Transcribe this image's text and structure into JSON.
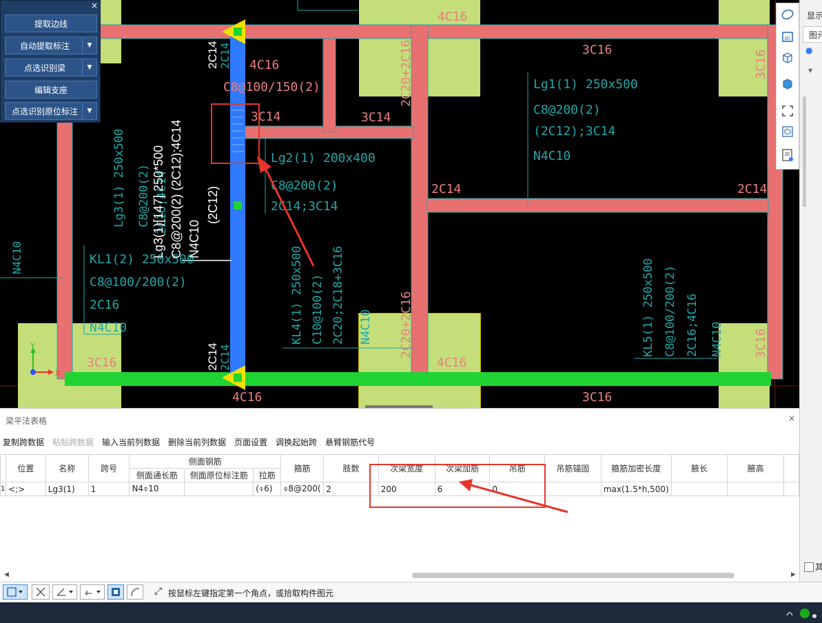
{
  "colors": {
    "canvas_bg": "#000000",
    "beam": "#e87070",
    "selected_beam": "#2f7bff",
    "bottom_beam": "#1ed432",
    "column": "#c4de7a",
    "annotation_text": "#1fa8a8",
    "annotation_red": "#e8342a",
    "white_text": "#ffffff",
    "pink_text": "#e88080",
    "axis_x": "#e8342a",
    "axis_y": "#22c422",
    "yellow_marker": "#f0e000"
  },
  "float_panel": {
    "close_icon": "×",
    "buttons": [
      {
        "label": "提取边线",
        "has_dropdown": false
      },
      {
        "label": "自动提取标注",
        "has_dropdown": true
      },
      {
        "label": "点选识别梁",
        "has_dropdown": true
      },
      {
        "label": "编辑支座",
        "has_dropdown": false
      },
      {
        "label": "点选识别原位标注",
        "has_dropdown": true
      }
    ],
    "dropdown_glyph": "▼"
  },
  "cad": {
    "beam_labels": {
      "kl1": [
        "KL1(2) 250x500",
        "C8@100/200(2)",
        "2C16",
        "N4C10"
      ],
      "lg3_teal": [
        "Lg3(1) 250x500",
        "C8@200(2)",
        "2C16;4C14"
      ],
      "lg3_white": [
        "Lg3(1)[147] 250*500",
        "C8@200(2) (2C12);4C14",
        "N4C10",
        "(2C12)"
      ],
      "lg1": [
        "Lg1(1) 250x500",
        "C8@200(2)",
        "(2C12);3C14",
        "N4C10"
      ],
      "lg2": [
        "Lg2(1) 200x400",
        "C8@200(2)",
        "2C14;3C14"
      ],
      "kl4": [
        "KL4(1) 250x500",
        "C10@100(2)",
        "2C20;2C18+3C16",
        "N4C10"
      ],
      "kl5": [
        "KL5(1) 250x500",
        "C8@100/200(2)",
        "2C16;4C16",
        "N4C10"
      ]
    },
    "misc_labels": {
      "top_4c16": "4C16",
      "top_3c16": "3C16",
      "right_3c16": "3C16",
      "mid_4c16": "4C16",
      "c8_100_150": "C8@100/150(2)",
      "left_3c14": "3C14",
      "mid_3c14": "3C14",
      "left_2c14": "2C14",
      "right_2c14": "2C14",
      "vert_2c20_top": "2C20+2C16",
      "vert_2c20_bot": "2C20+2C16",
      "white_2c14_top": "2C14",
      "teal_2c14_top": "2C14",
      "white_2c14_bot": "2C14",
      "teal_2c14_bot": "2C14",
      "left_3c16_bot": "3C16",
      "bot_4c16_left": "4C16",
      "bot_4c16_mid": "4C16",
      "bot_3c16": "3C16",
      "left_n4c10": "N4C10",
      "right_3c16_bot": "3C16",
      "kl4_n4c10": "N4C10"
    },
    "axis": {
      "x": "X",
      "y": "Y"
    }
  },
  "view_toolbar": {
    "icons": [
      "orbit-icon",
      "view-3d-icon",
      "cube-icon",
      "cube-solid-icon",
      "zoom-extents-icon",
      "component-icon",
      "properties-icon"
    ],
    "label_3d": "3D"
  },
  "right_panel": {
    "title": "显示",
    "tab": "图元",
    "radio": "●",
    "tree_arrow": "▼",
    "bottom_check": "其"
  },
  "bottom_panel": {
    "title": "梁平法表格",
    "close": "×",
    "menu": [
      {
        "label": "复制跨数据",
        "disabled": false
      },
      {
        "label": "粘贴跨数据",
        "disabled": true
      },
      {
        "label": "输入当前列数据",
        "disabled": false
      },
      {
        "label": "删除当前列数据",
        "disabled": false
      },
      {
        "label": "页面设置",
        "disabled": false
      },
      {
        "label": "调换起始跨",
        "disabled": false
      },
      {
        "label": "悬臂钢筋代号",
        "disabled": false
      }
    ],
    "group_header": "侧面钢筋",
    "columns": [
      "位置",
      "名称",
      "跨号",
      "侧面通长筋",
      "侧面原位标注筋",
      "拉筋",
      "箍筋",
      "肢数",
      "次梁宽度",
      "次梁加筋",
      "吊筋",
      "吊筋锚固",
      "箍筋加密长度",
      "腋长",
      "腋高"
    ],
    "rows": [
      {
        "index": "1",
        "cells": [
          "<;>",
          "Lg3(1)",
          "1",
          "N4⌽10",
          "",
          "(⌽6)",
          "⌽8@200(",
          "2",
          "200",
          "6",
          "0",
          "",
          "max(1.5*h,500)",
          "",
          ""
        ]
      }
    ],
    "scroll_left": "◀",
    "scroll_right": "▶"
  },
  "status_bar": {
    "text": "按鼠标左键指定第一个角点，或拾取构件图元",
    "cursor_glyph": "⤢"
  }
}
